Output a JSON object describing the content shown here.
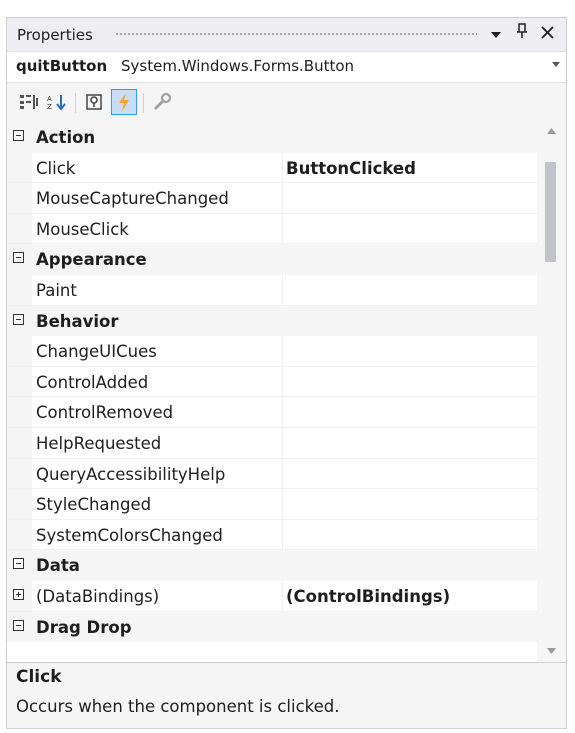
{
  "window": {
    "title": "Properties",
    "dropdown_icon": "triangle-down",
    "pin_icon": "pin",
    "close_icon": "close"
  },
  "object_selector": {
    "name": "quitButton",
    "type": "System.Windows.Forms.Button"
  },
  "toolbar": {
    "tools": [
      {
        "icon": "categorized-icon",
        "active": false
      },
      {
        "icon": "alphabetical-icon",
        "active": false
      },
      {
        "icon": "properties-icon",
        "active": false
      },
      {
        "icon": "events-icon",
        "active": true
      },
      {
        "icon": "property-pages-icon",
        "active": false
      }
    ]
  },
  "grid": {
    "rows": [
      {
        "kind": "category",
        "name": "Action",
        "expanded": true
      },
      {
        "kind": "property",
        "name": "Click",
        "value": "ButtonClicked"
      },
      {
        "kind": "property",
        "name": "MouseCaptureChanged",
        "value": ""
      },
      {
        "kind": "property",
        "name": "MouseClick",
        "value": ""
      },
      {
        "kind": "category",
        "name": "Appearance",
        "expanded": true
      },
      {
        "kind": "property",
        "name": "Paint",
        "value": ""
      },
      {
        "kind": "category",
        "name": "Behavior",
        "expanded": true
      },
      {
        "kind": "property",
        "name": "ChangeUICues",
        "value": ""
      },
      {
        "kind": "property",
        "name": "ControlAdded",
        "value": ""
      },
      {
        "kind": "property",
        "name": "ControlRemoved",
        "value": ""
      },
      {
        "kind": "property",
        "name": "HelpRequested",
        "value": ""
      },
      {
        "kind": "property",
        "name": "QueryAccessibilityHelp",
        "value": ""
      },
      {
        "kind": "property",
        "name": "StyleChanged",
        "value": ""
      },
      {
        "kind": "property",
        "name": "SystemColorsChanged",
        "value": ""
      },
      {
        "kind": "category",
        "name": "Data",
        "expanded": true
      },
      {
        "kind": "property",
        "name": "(DataBindings)",
        "value": "(ControlBindings)",
        "expandable": true
      },
      {
        "kind": "category",
        "name": "Drag Drop",
        "expanded": true
      }
    ]
  },
  "description": {
    "title": "Click",
    "text": "Occurs when the component is clicked."
  },
  "colors": {
    "panel_bg": "#f5f5f5",
    "grid_bg": "#ffffff",
    "active_tool_bg": "#c9def5",
    "active_tool_border": "#3399ff",
    "events_icon_color": "#f5a623",
    "scroll_thumb": "#c2c3c9"
  }
}
